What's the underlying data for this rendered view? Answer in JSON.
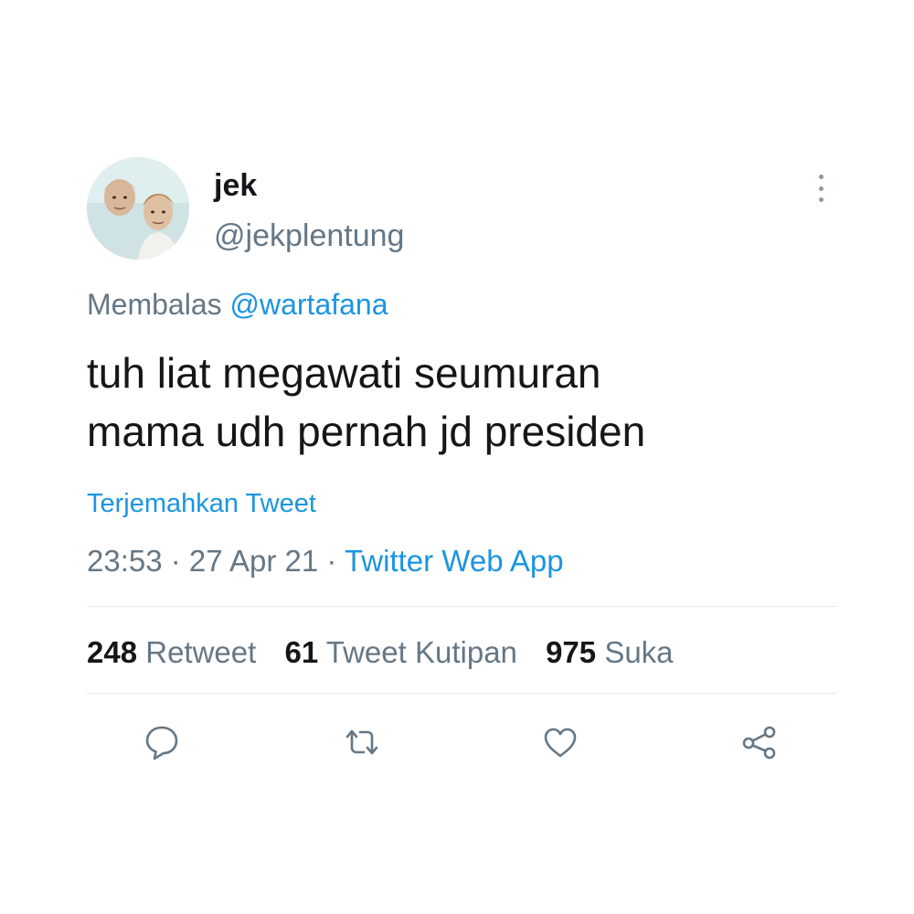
{
  "tweet": {
    "author": {
      "display_name": "jek",
      "handle": "@jekplentung"
    },
    "reply_prefix": "Membalas",
    "reply_to": "@wartafana",
    "text": "tuh liat megawati seumuran\nmama udh pernah jd presiden",
    "translate_label": "Terjemahkan Tweet",
    "time": "23:53",
    "separator": " · ",
    "date": "27 Apr 21",
    "source": "Twitter Web App"
  },
  "stats": {
    "retweets": {
      "count": "248",
      "label": "Retweet"
    },
    "quotes": {
      "count": "61",
      "label": "Tweet Kutipan"
    },
    "likes": {
      "count": "975",
      "label": "Suka"
    }
  },
  "actions": [
    {
      "icon": "reply-icon"
    },
    {
      "icon": "retweet-icon"
    },
    {
      "icon": "like-icon"
    },
    {
      "icon": "share-icon"
    }
  ],
  "colors": {
    "accent": "#1b95e0",
    "secondary_text": "#657786",
    "primary_text": "#14171a",
    "divider": "#e1e8ed"
  }
}
